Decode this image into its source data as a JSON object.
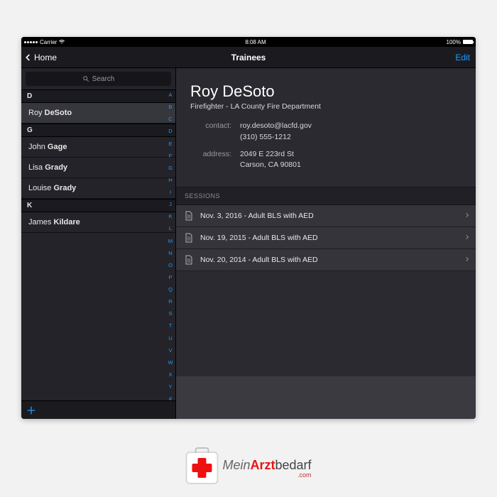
{
  "statusbar": {
    "carrier": "Carrier",
    "time": "8:08 AM",
    "battery": "100%"
  },
  "nav": {
    "back_label": "Home",
    "title": "Trainees",
    "edit_label": "Edit"
  },
  "search": {
    "placeholder": "Search"
  },
  "index_letters": [
    "A",
    "B",
    "C",
    "D",
    "E",
    "F",
    "G",
    "H",
    "I",
    "J",
    "K",
    "L",
    "M",
    "N",
    "O",
    "P",
    "Q",
    "R",
    "S",
    "T",
    "U",
    "V",
    "W",
    "X",
    "Y",
    "#"
  ],
  "sections": [
    {
      "letter": "D",
      "rows": [
        {
          "first": "Roy",
          "last": "DeSoto",
          "selected": true
        }
      ]
    },
    {
      "letter": "G",
      "rows": [
        {
          "first": "John",
          "last": "Gage"
        },
        {
          "first": "Lisa",
          "last": "Grady"
        },
        {
          "first": "Louise",
          "last": "Grady"
        }
      ]
    },
    {
      "letter": "K",
      "rows": [
        {
          "first": "James",
          "last": "Kildare"
        }
      ]
    }
  ],
  "detail": {
    "name": "Roy DeSoto",
    "subtitle": "Firefighter - LA County Fire Department",
    "contact_label": "contact:",
    "contact_email": "roy.desoto@lacfd.gov",
    "contact_phone": "(310) 555-1212",
    "address_label": "address:",
    "address_line1": "2049 E 223rd St",
    "address_line2": "Carson, CA 90801",
    "sessions_header": "SESSIONS",
    "sessions": [
      {
        "label": "Nov. 3, 2016 - Adult BLS with AED"
      },
      {
        "label": "Nov. 19, 2015 - Adult BLS with AED"
      },
      {
        "label": "Nov. 20, 2014 - Adult BLS with AED"
      }
    ]
  },
  "branding": {
    "part1": "Mein",
    "part2": "Arzt",
    "part3": "bedarf",
    "domain": ".com"
  }
}
